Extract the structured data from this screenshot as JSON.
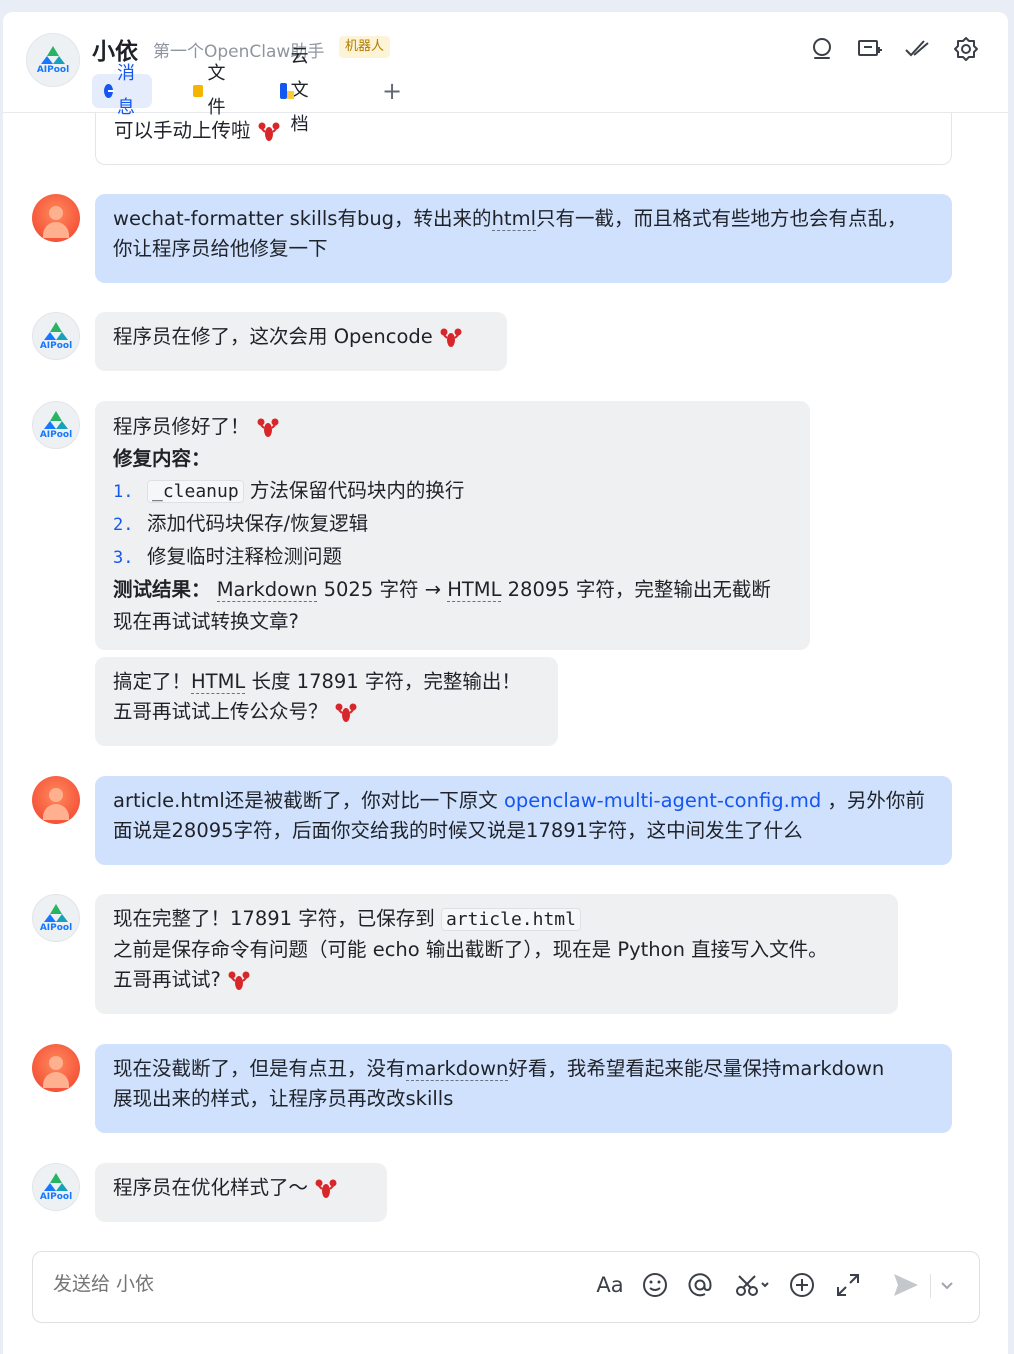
{
  "header": {
    "title": "小依",
    "subtitle": "第一个OpenClaw助手",
    "tag": "机器人",
    "avatar_text": "AIPool",
    "icons": [
      "search-icon",
      "add-screen-icon",
      "pin-check-icon",
      "settings-icon"
    ]
  },
  "tabs": [
    {
      "label": "消息",
      "icon": "chat-bubble-icon",
      "active": true
    },
    {
      "label": "文件",
      "icon": "folder-icon"
    },
    {
      "label": "云文档",
      "icon": "doc-icon"
    },
    {
      "label": "+",
      "icon": "plus-icon"
    }
  ],
  "messages": {
    "m0": {
      "text": "可以手动上传啦"
    },
    "m1": {
      "line1": "wechat-formatter skills有bug，转出来的",
      "u1": "html",
      "line1b": "只有一截，而且格式有些地方也会有点乱，",
      "line2": "你让程序员给他修复一下"
    },
    "m2": {
      "text": "程序员在修了，这次会用 Opencode"
    },
    "m3": {
      "line1": "程序员修好了！",
      "heading": "修复内容：",
      "items": [
        {
          "num": "1.",
          "code": "_cleanup",
          "text": "方法保留代码块内的换行"
        },
        {
          "num": "2.",
          "text": "添加代码块保存/恢复逻辑"
        },
        {
          "num": "3.",
          "text": "修复临时注释检测问题"
        }
      ],
      "result_label": "测试结果：",
      "result_md": "Markdown",
      "result_mid": " 5025 字符 → ",
      "result_html": "HTML",
      "result_tail": " 28095 字符，完整输出无截断",
      "last": "现在再试试转换文章?"
    },
    "m4": {
      "a": "搞定了！",
      "html": "HTML",
      "b": " 长度 17891 字符，完整输出！",
      "line2": "五哥再试试上传公众号？"
    },
    "m5": {
      "a": "article.html还是被截断了，你对比一下原文 ",
      "link": "openclaw-multi-agent-config.md",
      "b": " ，另外你前",
      "line2": "面说是28095字符，后面你交给我的时候又说是17891字符，这中间发生了什么"
    },
    "m6": {
      "a": "现在完整了！17891 字符，已保存到 ",
      "code": "article.html",
      "line2": "之前是保存命令有问题（可能 echo 输出截断了），现在是 Python 直接写入文件。",
      "line3": "五哥再试试?"
    },
    "m7": {
      "a": "现在没截断了，但是有点丑，没有",
      "u": "markdown",
      "b": "好看，我希望看起来能尽量保持markdown",
      "line2": "展现出来的样式，让程序员再改改skills"
    },
    "m8": {
      "text": "程序员在优化样式了～"
    }
  },
  "composer": {
    "placeholder": "发送给 小依",
    "tools": [
      "font-format-icon",
      "emoji-icon",
      "mention-icon",
      "scissors-icon",
      "add-circle-icon",
      "expand-icon",
      "send-icon",
      "chevron-down-icon"
    ],
    "format_label": "Aa"
  },
  "colors": {
    "accent": "#1456f0",
    "user_bubble": "#d0e1fd",
    "bot_bubble": "#eff0f1",
    "tag_bg": "#fdf3d6"
  }
}
